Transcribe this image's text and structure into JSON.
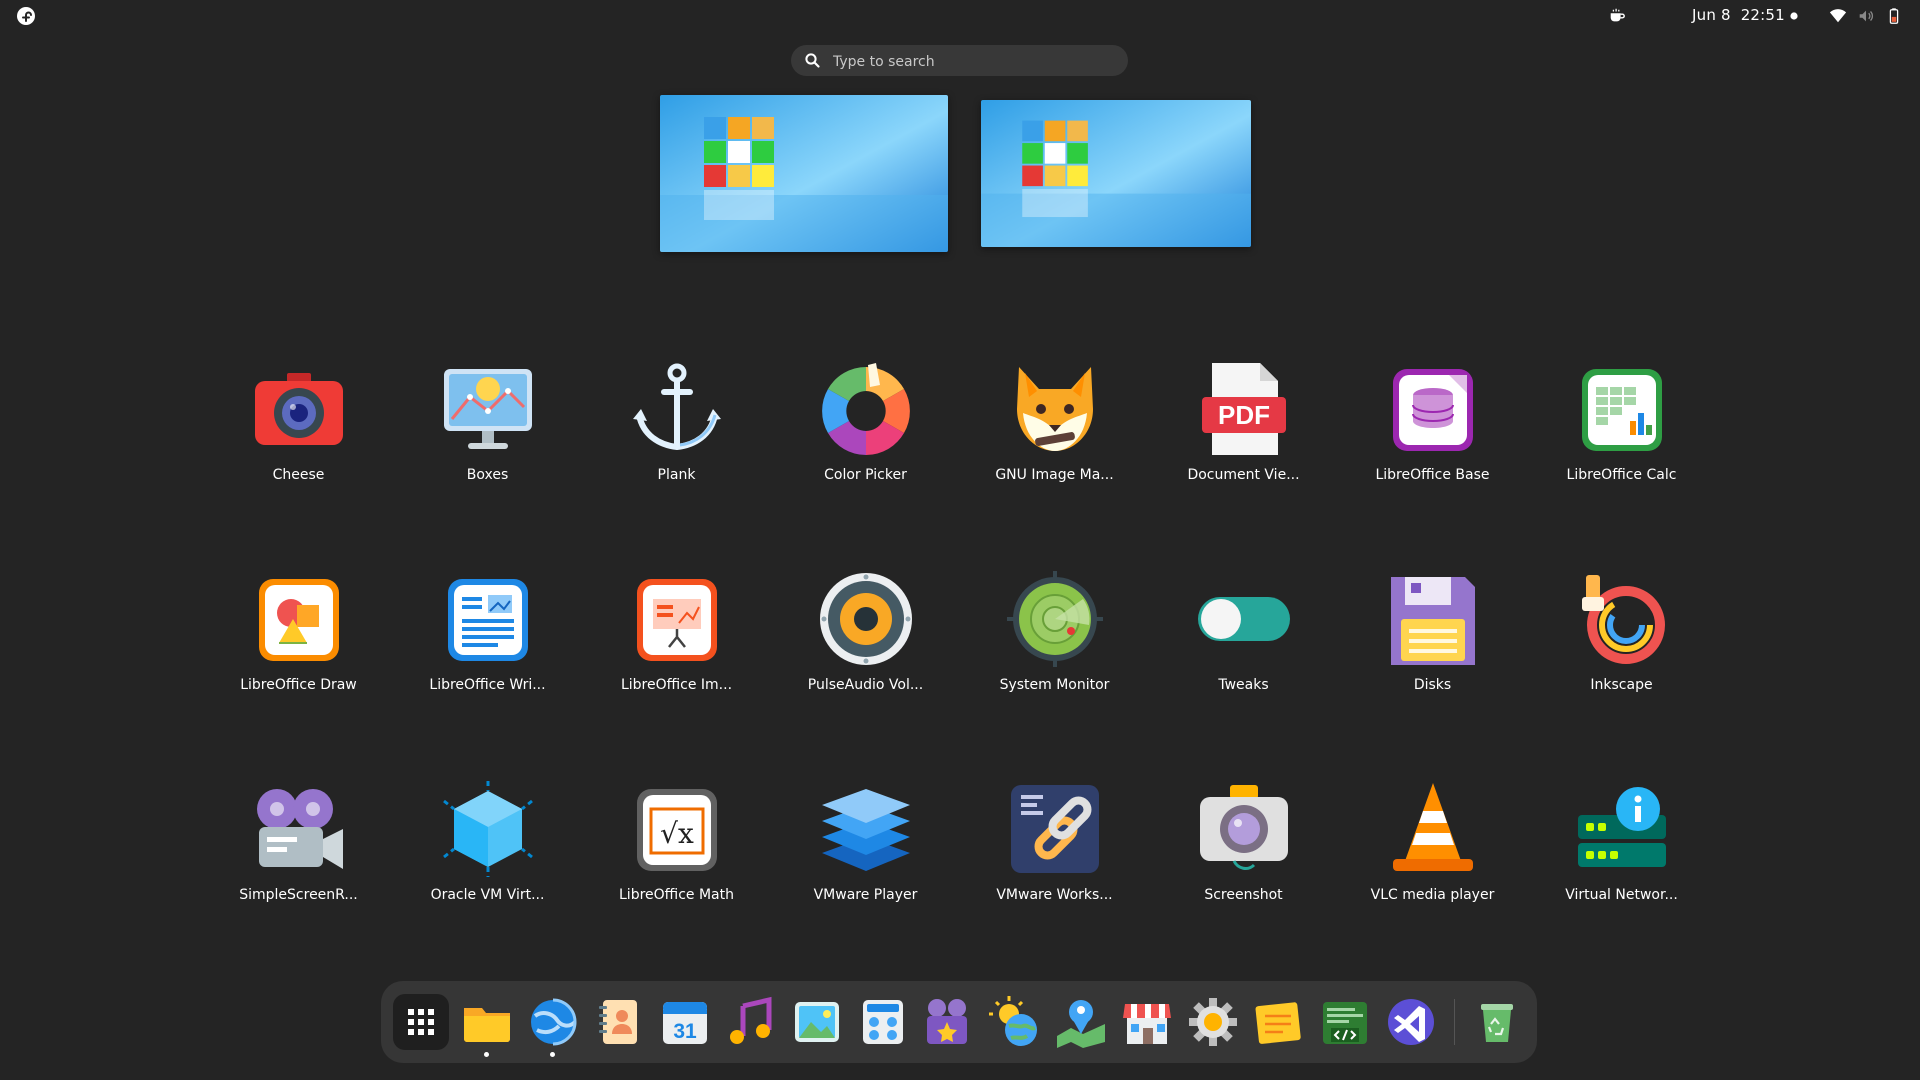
{
  "topbar": {
    "date": "Jun 8",
    "time": "22:51"
  },
  "search": {
    "placeholder": "Type to search"
  },
  "apps": [
    {
      "label": "Cheese",
      "icon": "camera-icon"
    },
    {
      "label": "Boxes",
      "icon": "monitor-icon"
    },
    {
      "label": "Plank",
      "icon": "anchor-icon"
    },
    {
      "label": "Color Picker",
      "icon": "color-wheel-icon"
    },
    {
      "label": "GNU Image Ma...",
      "icon": "fox-icon"
    },
    {
      "label": "Document Vie...",
      "icon": "pdf-icon"
    },
    {
      "label": "LibreOffice Base",
      "icon": "database-icon"
    },
    {
      "label": "LibreOffice Calc",
      "icon": "spreadsheet-icon"
    },
    {
      "label": "LibreOffice Draw",
      "icon": "draw-icon"
    },
    {
      "label": "LibreOffice Wri...",
      "icon": "writer-icon"
    },
    {
      "label": "LibreOffice Im...",
      "icon": "impress-icon"
    },
    {
      "label": "PulseAudio Vol...",
      "icon": "speaker-icon"
    },
    {
      "label": "System Monitor",
      "icon": "radar-icon"
    },
    {
      "label": "Tweaks",
      "icon": "toggle-icon"
    },
    {
      "label": "Disks",
      "icon": "floppy-icon"
    },
    {
      "label": "Inkscape",
      "icon": "inkscape-icon"
    },
    {
      "label": "SimpleScreenR...",
      "icon": "film-camera-icon"
    },
    {
      "label": "Oracle VM Virt...",
      "icon": "cube-icon"
    },
    {
      "label": "LibreOffice Math",
      "icon": "math-icon"
    },
    {
      "label": "VMware Player",
      "icon": "layers-icon"
    },
    {
      "label": "VMware Works...",
      "icon": "chain-link-icon"
    },
    {
      "label": "Screenshot",
      "icon": "screenshot-camera-icon"
    },
    {
      "label": "VLC media player",
      "icon": "traffic-cone-icon"
    },
    {
      "label": "Virtual Networ...",
      "icon": "network-info-icon"
    }
  ],
  "dock": [
    {
      "name": "app-grid-icon",
      "running": false
    },
    {
      "name": "folder-icon",
      "running": true
    },
    {
      "name": "web-browser-icon",
      "running": true
    },
    {
      "name": "contacts-icon",
      "running": false
    },
    {
      "name": "calendar-icon",
      "running": false,
      "text": "31"
    },
    {
      "name": "music-icon",
      "running": false
    },
    {
      "name": "image-viewer-icon",
      "running": false
    },
    {
      "name": "calculator-icon",
      "running": false
    },
    {
      "name": "video-editor-icon",
      "running": false
    },
    {
      "name": "weather-icon",
      "running": false
    },
    {
      "name": "maps-icon",
      "running": false
    },
    {
      "name": "software-store-icon",
      "running": false
    },
    {
      "name": "settings-gear-icon",
      "running": false
    },
    {
      "name": "notes-icon",
      "running": false
    },
    {
      "name": "code-editor-icon",
      "running": false
    },
    {
      "name": "visual-studio-icon",
      "running": false
    },
    {
      "name": "trash-icon",
      "running": false
    }
  ],
  "colors": {
    "background": "#242424",
    "dock": "#363636",
    "search": "#383838"
  }
}
